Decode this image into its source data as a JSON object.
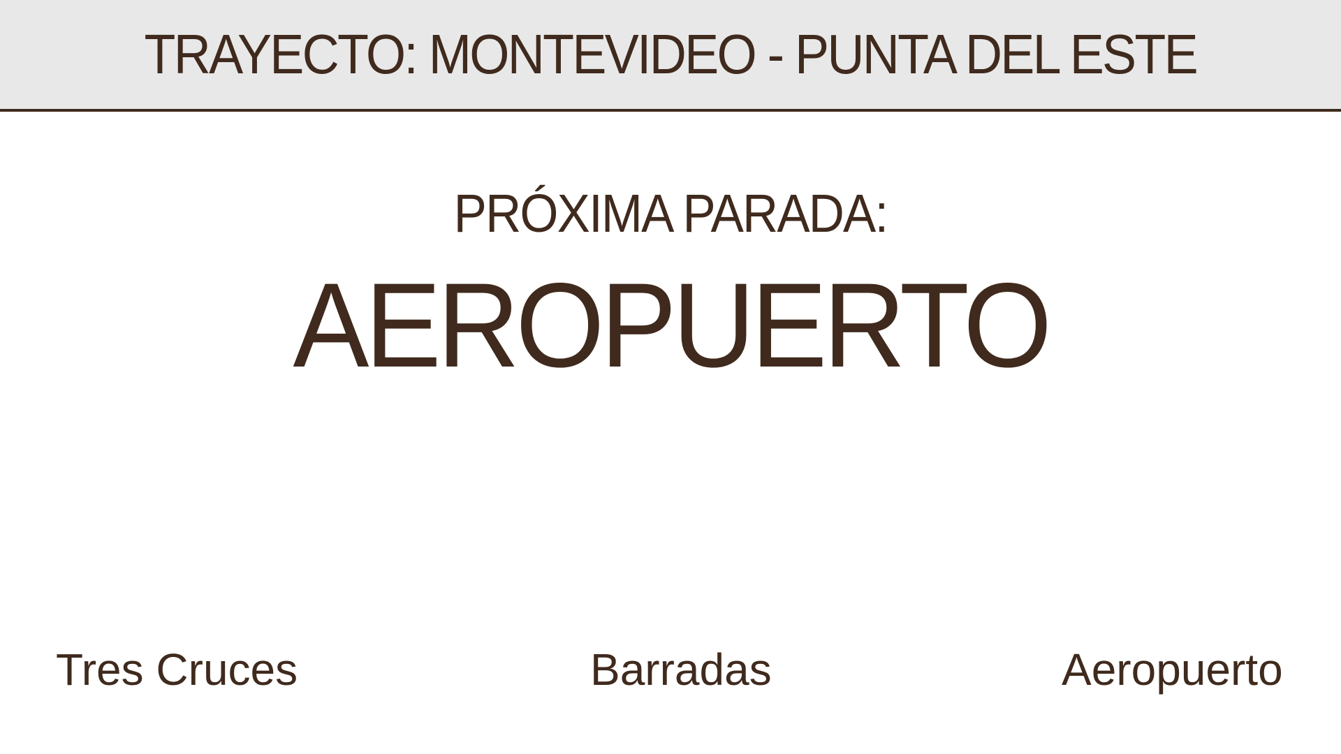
{
  "header": {
    "route_title": "TRAYECTO: MONTEVIDEO - PUNTA DEL ESTE"
  },
  "main": {
    "next_stop_label": "PRÓXIMA PARADA:",
    "next_stop_name": "AEROPUERTO"
  },
  "stops": [
    {
      "label": "Tres Cruces"
    },
    {
      "label": "Barradas"
    },
    {
      "label": "Aeropuerto"
    }
  ],
  "colors": {
    "text": "#3f2a1d",
    "header_background": "#e8e8e8",
    "background": "#ffffff"
  }
}
